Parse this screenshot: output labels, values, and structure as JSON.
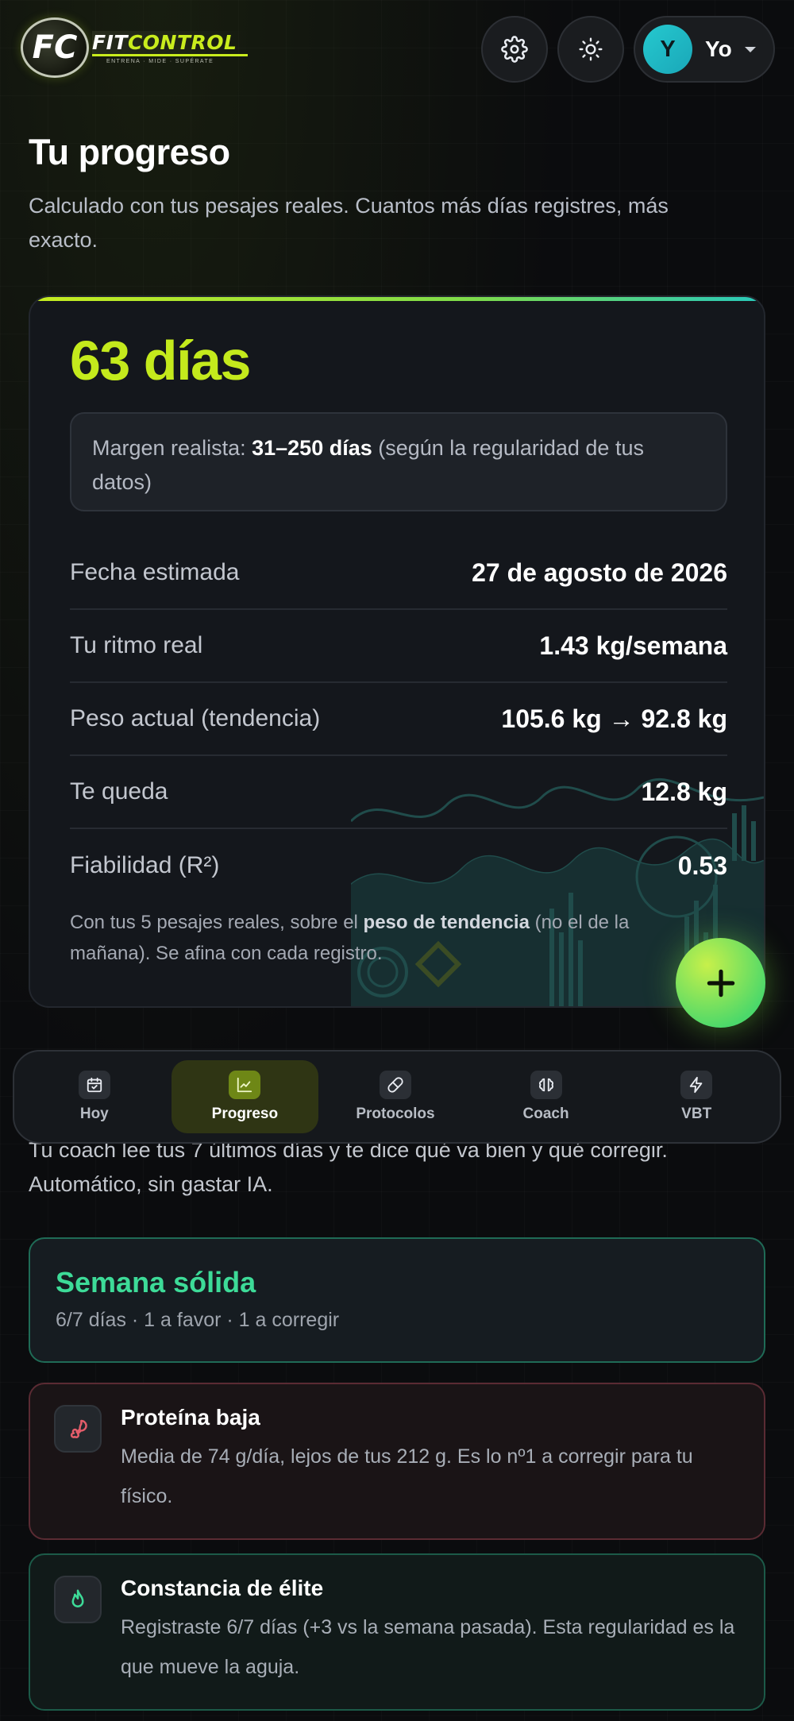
{
  "brand": {
    "name_part1": "FIT",
    "name_part2": "CONTROL",
    "tagline": "ENTRENA · MIDE · SUPÉRATE",
    "mark_letters": "FC"
  },
  "header": {
    "settings_icon": "gear-icon",
    "theme_icon": "sun-icon",
    "user": {
      "initial": "Y",
      "name": "Yo"
    }
  },
  "page": {
    "title": "Tu progreso",
    "subtitle": "Calculado con tus pesajes reales. Cuantos más días registres, más exacto."
  },
  "progress_card": {
    "days": "63 días",
    "margin_label": "Margen realista:",
    "margin_value": "31–250 días",
    "margin_note": "(según la regularidad de tus datos)",
    "rows": [
      {
        "label": "Fecha estimada",
        "value": "27 de agosto de 2026"
      },
      {
        "label": "Tu ritmo real",
        "value": "1.43 kg/semana"
      },
      {
        "label": "Peso actual (tendencia)",
        "value": "105.6 kg → 92.8 kg"
      },
      {
        "label": "Te queda",
        "value": "12.8 kg"
      },
      {
        "label": "Fiabilidad (R²)",
        "value": "0.53"
      }
    ],
    "note_prefix": "Con tus 5 pesajes reales, sobre el",
    "note_bold": "peso de tendencia",
    "note_suffix": "(no el de la mañana). Se afina con cada registro."
  },
  "fab": {
    "label": "+"
  },
  "nav": {
    "items": [
      {
        "label": "Hoy",
        "icon": "calendar-icon",
        "active": false
      },
      {
        "label": "Progreso",
        "icon": "chart-icon",
        "active": true
      },
      {
        "label": "Protocolos",
        "icon": "pill-icon",
        "active": false
      },
      {
        "label": "Coach",
        "icon": "brain-icon",
        "active": false
      },
      {
        "label": "VBT",
        "icon": "lightning-icon",
        "active": false
      }
    ]
  },
  "coach": {
    "intro": "Tu coach lee tus 7 últimos días y te dice qué va bien y qué corregir. Automático, sin gastar IA.",
    "week": {
      "title": "Semana sólida",
      "meta": "6/7 días · 1 a favor · 1 a corregir"
    },
    "insights": [
      {
        "title": "Proteína baja",
        "body": "Media de 74 g/día, lejos de tus 212 g. Es lo nº1 a corregir para tu físico.",
        "icon": "drumstick-icon",
        "status": "negative",
        "color": "#e35d6a"
      },
      {
        "title": "Constancia de élite",
        "body": "Registraste 6/7 días (+3 vs la semana pasada). Esta regularidad es la que mueve la aguja.",
        "icon": "flame-icon",
        "status": "positive",
        "color": "#3ddb98"
      }
    ]
  },
  "colors": {
    "accent": "#c4ea1c",
    "teal": "#25c9cf",
    "background": "#0b0c0e"
  }
}
